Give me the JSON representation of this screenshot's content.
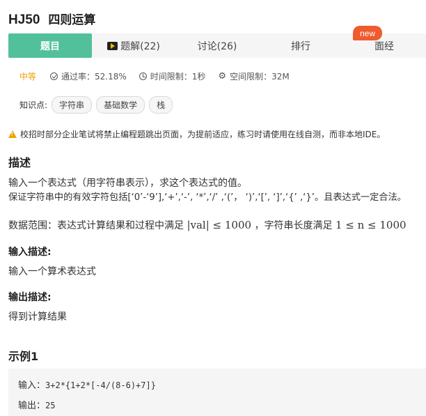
{
  "problem": {
    "id": "HJ50",
    "name": "四则运算"
  },
  "tabs": [
    {
      "label": "题目",
      "active": true
    },
    {
      "label": "题解(22)",
      "icon": "video-play-icon"
    },
    {
      "label": "讨论(26)"
    },
    {
      "label": "排行"
    },
    {
      "label": "面经",
      "badge": "new"
    }
  ],
  "meta": {
    "difficulty": "中等",
    "pass_rate": "通过率：52.18%",
    "time_limit": "时间限制：1秒",
    "space_limit": "空间限制：32M"
  },
  "tags": {
    "label": "知识点:",
    "items": [
      "字符串",
      "基础数学",
      "栈"
    ]
  },
  "notice": "校招时部分企业笔试将禁止编程题跳出页面，为提前适应，练习时请使用在线自测，而非本地IDE。",
  "description": {
    "heading": "描述",
    "line1": "输入一个表达式（用字符串表示），求这个表达式的值。",
    "line2": "保证字符串中的有效字符包括[‘0’-‘9’],‘+’,‘-’, ‘*’,‘/’ ,‘(’， ‘)’,‘[’, ‘]’,‘{’ ,‘}’。且表达式一定合法。",
    "range_prefix": "数据范围：表达式计算结果和过程中满足 ",
    "range_math1": "|val| ≤ 1000",
    "range_middle": " ，字符串长度满足 ",
    "range_math2": "1 ≤ n ≤ 1000"
  },
  "input_desc": {
    "heading": "输入描述:",
    "text": "输入一个算术表达式"
  },
  "output_desc": {
    "heading": "输出描述:",
    "text": "得到计算结果"
  },
  "example": {
    "heading": "示例1",
    "input_label": "输入：",
    "input_value": "3+2*{1+2*[-4/(8-6)+7]}",
    "output_label": "输出：",
    "output_value": "25"
  },
  "colors": {
    "accent": "#52c09a",
    "difficulty": "#f0a000",
    "badge": "#ef5a2e"
  }
}
